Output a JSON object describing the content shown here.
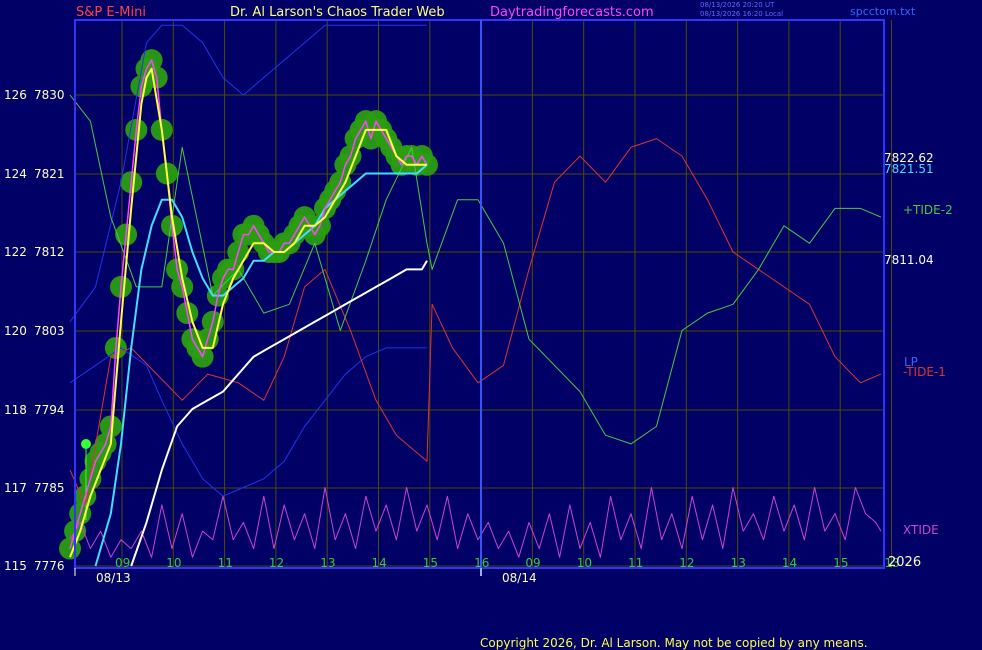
{
  "header": {
    "symbol": "S&P E-Mini",
    "site": "Dr. Al Larson's Chaos Trader Web",
    "url": "Daytradingforecasts.com",
    "time_line1": "08/13/2026 20:20 UT",
    "time_line2": "08/13/2026 16:20 Local",
    "filename": "spcctom.txt"
  },
  "footer": {
    "copyright": "Copyright 2026, Dr. Al Larson. May not be copied by any means."
  },
  "colors": {
    "background": "#000066",
    "frame": "#3333ff",
    "grid": "#4d4d00",
    "price": "#ff44ff",
    "fast_ma": "#ffff44",
    "slow_ma": "#44ddff",
    "long_ma": "#ffffff",
    "bands": "#2233ee",
    "tide_plus2": "#44cc44",
    "tide_minus1": "#dd3333",
    "xtide": "#cc44cc",
    "glow": "#2a9d12"
  },
  "chart_data": {
    "type": "line",
    "title": "S&P E-Mini",
    "y_axis_left": [
      {
        "label": "126",
        "value": 7830
      },
      {
        "label": "124",
        "value": 7821
      },
      {
        "label": "122",
        "value": 7812
      },
      {
        "label": "120",
        "value": 7803
      },
      {
        "label": "118",
        "value": 7794
      },
      {
        "label": "117",
        "value": 7785
      },
      {
        "label": "115",
        "value": 7776
      }
    ],
    "ylim": [
      7776,
      7835
    ],
    "x_hour_labels": [
      "09",
      "10",
      "11",
      "12",
      "13",
      "14",
      "15",
      "16",
      "09",
      "10",
      "11",
      "12",
      "13",
      "14",
      "15",
      "13"
    ],
    "date_labels": [
      "08/13",
      "08/14"
    ],
    "year_label": "2026",
    "right_values": [
      "7822.62",
      "7821.51",
      "7811.04"
    ],
    "series": [
      {
        "name": "+TIDE-2",
        "x": [
          0,
          0.4,
          0.8,
          1.3,
          1.8,
          2.2,
          2.8,
          3.3,
          3.8,
          4.3,
          4.8,
          5.3,
          5.8,
          6.2,
          6.7,
          7.0,
          7.1,
          7.6,
          8.0,
          8.5,
          9.0,
          9.5,
          10.0,
          10.5,
          11.0,
          11.5,
          12.0,
          12.5,
          13.0,
          13.5,
          14.0,
          14.5,
          15.0,
          15.5,
          15.9
        ],
        "values": [
          7830,
          7827,
          7816,
          7808,
          7808,
          7824,
          7807,
          7810,
          7805,
          7806,
          7813,
          7803,
          7811,
          7818,
          7824,
          7813,
          7810,
          7818,
          7818,
          7813,
          7802,
          7799,
          7796,
          7791,
          7790,
          7792,
          7803,
          7805,
          7806,
          7810,
          7815,
          7813,
          7817,
          7817,
          7816
        ]
      },
      {
        "name": "-TIDE-1",
        "x": [
          0,
          0.3,
          0.8,
          1.2,
          1.7,
          2.2,
          2.7,
          3.3,
          3.8,
          4.2,
          4.6,
          5.0,
          5.5,
          6.0,
          6.4,
          6.8,
          7.0,
          7.1,
          7.5,
          8.0,
          8.5,
          9.0,
          9.5,
          10.0,
          10.5,
          11.0,
          11.5,
          12.0,
          12.5,
          13.0,
          13.5,
          14.0,
          14.5,
          15.0,
          15.5,
          15.9
        ],
        "values": [
          7787,
          7783,
          7800,
          7801,
          7798,
          7795,
          7798,
          7797,
          7795,
          7800,
          7808,
          7810,
          7803,
          7795,
          7791,
          7789,
          7788,
          7806,
          7801,
          7797,
          7799,
          7810,
          7820,
          7823,
          7820,
          7824,
          7825,
          7823,
          7818,
          7812,
          7810,
          7808,
          7806,
          7800,
          7797,
          7798
        ]
      },
      {
        "name": "XTIDE",
        "x": [
          0,
          0.2,
          0.4,
          0.6,
          0.8,
          1.0,
          1.2,
          1.4,
          1.6,
          1.8,
          2.0,
          2.2,
          2.4,
          2.6,
          2.8,
          3.0,
          3.2,
          3.4,
          3.6,
          3.8,
          4.0,
          4.2,
          4.4,
          4.6,
          4.8,
          5.0,
          5.2,
          5.4,
          5.6,
          5.8,
          6.0,
          6.2,
          6.4,
          6.6,
          6.8,
          7.0,
          7.2,
          7.4,
          7.6,
          7.8,
          8.0,
          8.2,
          8.4,
          8.6,
          8.8,
          9.0,
          9.2,
          9.4,
          9.6,
          9.8,
          10.0,
          10.2,
          10.4,
          10.6,
          10.8,
          11.0,
          11.2,
          11.4,
          11.6,
          11.8,
          12.0,
          12.2,
          12.4,
          12.6,
          12.8,
          13.0,
          13.2,
          13.4,
          13.6,
          13.8,
          14.0,
          14.2,
          14.4,
          14.6,
          14.8,
          15.0,
          15.2,
          15.4,
          15.6,
          15.8,
          15.9
        ],
        "values": [
          7779,
          7781,
          7778,
          7780,
          7777,
          7779,
          7778,
          7780,
          7777,
          7783,
          7778,
          7782,
          7777,
          7780,
          7779,
          7784,
          7779,
          7781,
          7778,
          7784,
          7778,
          7783,
          7779,
          7782,
          7778,
          7785,
          7779,
          7782,
          7778,
          7784,
          7780,
          7783,
          7779,
          7785,
          7780,
          7783,
          7779,
          7784,
          7778,
          7782,
          7779,
          7781,
          7778,
          7780,
          7777,
          7781,
          7778,
          7782,
          7777,
          7783,
          7778,
          7781,
          7777,
          7784,
          7779,
          7782,
          7778,
          7785,
          7779,
          7782,
          7778,
          7784,
          7779,
          7783,
          7778,
          7785,
          7780,
          7782,
          7779,
          7784,
          7780,
          7783,
          7779,
          7785,
          7780,
          7782,
          7779,
          7785,
          7782,
          7781,
          7780
        ]
      },
      {
        "name": "S&P E-Mini",
        "x": [
          0.0,
          0.1,
          0.2,
          0.3,
          0.4,
          0.5,
          0.6,
          0.7,
          0.8,
          0.9,
          1.0,
          1.1,
          1.2,
          1.3,
          1.4,
          1.5,
          1.6,
          1.7,
          1.8,
          1.9,
          2.0,
          2.1,
          2.2,
          2.3,
          2.4,
          2.5,
          2.6,
          2.7,
          2.8,
          2.9,
          3.0,
          3.1,
          3.2,
          3.3,
          3.4,
          3.5,
          3.6,
          3.7,
          3.8,
          3.9,
          4.0,
          4.1,
          4.2,
          4.3,
          4.4,
          4.5,
          4.6,
          4.7,
          4.8,
          4.9,
          5.0,
          5.1,
          5.2,
          5.3,
          5.4,
          5.5,
          5.6,
          5.7,
          5.8,
          5.9,
          6.0,
          6.1,
          6.2,
          6.3,
          6.4,
          6.5,
          6.6,
          6.7,
          6.8,
          6.9,
          7.0
        ],
        "values": [
          7778,
          7780,
          7782,
          7784,
          7786,
          7788,
          7789,
          7790,
          7792,
          7801,
          7808,
          7814,
          7820,
          7826,
          7831,
          7833,
          7834,
          7832,
          7826,
          7821,
          7815,
          7810,
          7808,
          7805,
          7802,
          7801,
          7800,
          7802,
          7804,
          7807,
          7809,
          7810,
          7810,
          7812,
          7814,
          7814,
          7815,
          7814,
          7813,
          7812,
          7812,
          7812,
          7813,
          7813,
          7814,
          7815,
          7816,
          7815,
          7814,
          7815,
          7817,
          7818,
          7819,
          7820,
          7822,
          7823,
          7825,
          7826,
          7827,
          7825,
          7827,
          7826,
          7825,
          7824,
          7823,
          7822,
          7823,
          7823,
          7822,
          7823,
          7822
        ]
      },
      {
        "name": "fast average",
        "x": [
          0.0,
          0.2,
          0.4,
          0.6,
          0.8,
          1.0,
          1.2,
          1.4,
          1.5,
          1.6,
          1.8,
          2.0,
          2.2,
          2.4,
          2.6,
          2.8,
          3.0,
          3.2,
          3.4,
          3.6,
          3.8,
          4.0,
          4.2,
          4.4,
          4.6,
          4.8,
          5.0,
          5.2,
          5.4,
          5.6,
          5.8,
          6.0,
          6.2,
          6.4,
          6.6,
          6.8,
          7.0
        ],
        "values": [
          7777,
          7780,
          7784,
          7787,
          7790,
          7804,
          7817,
          7829,
          7832,
          7833,
          7826,
          7816,
          7809,
          7804,
          7801,
          7801,
          7806,
          7809,
          7811,
          7813,
          7813,
          7812,
          7812,
          7813,
          7815,
          7815,
          7816,
          7818,
          7820,
          7823,
          7826,
          7826,
          7826,
          7823,
          7822,
          7822,
          7822
        ]
      },
      {
        "name": "slow average",
        "x": [
          0.5,
          0.8,
          1.0,
          1.2,
          1.4,
          1.6,
          1.8,
          2.0,
          2.2,
          2.4,
          2.6,
          2.8,
          3.0,
          3.2,
          3.4,
          3.6,
          3.8,
          4.0,
          4.2,
          4.4,
          4.6,
          4.8,
          5.0,
          5.2,
          5.4,
          5.6,
          5.8,
          6.0,
          6.2,
          6.4,
          6.6,
          6.8,
          7.0
        ],
        "values": [
          7776,
          7782,
          7790,
          7801,
          7810,
          7815,
          7818,
          7818,
          7816,
          7812,
          7809,
          7807,
          7807,
          7808,
          7809,
          7811,
          7811,
          7812,
          7812,
          7813,
          7814,
          7815,
          7817,
          7818,
          7819,
          7820,
          7821,
          7821,
          7821,
          7821,
          7821,
          7821,
          7822
        ]
      },
      {
        "name": "long average",
        "x": [
          1.2,
          1.5,
          1.8,
          2.1,
          2.4,
          2.7,
          3.0,
          3.3,
          3.6,
          3.9,
          4.2,
          4.5,
          4.8,
          5.1,
          5.4,
          5.7,
          6.0,
          6.3,
          6.6,
          6.9,
          7.0
        ],
        "values": [
          7776,
          7781,
          7787,
          7792,
          7794,
          7795,
          7796,
          7798,
          7800,
          7801,
          7802,
          7803,
          7804,
          7805,
          7806,
          7807,
          7808,
          7809,
          7810,
          7810,
          7811
        ]
      },
      {
        "name": "upper band",
        "x": [
          0.0,
          0.5,
          1.0,
          1.5,
          1.8,
          2.2,
          2.6,
          3.0,
          3.4,
          3.8,
          4.2,
          4.6,
          5.0,
          5.4,
          5.8,
          6.2,
          6.6,
          7.0
        ],
        "values": [
          7804,
          7808,
          7820,
          7836,
          7838,
          7838,
          7836,
          7832,
          7830,
          7832,
          7834,
          7836,
          7838,
          7838,
          7838,
          7838,
          7838,
          7838
        ]
      },
      {
        "name": "lower band",
        "x": [
          0.0,
          0.5,
          1.0,
          1.5,
          1.8,
          2.2,
          2.6,
          3.0,
          3.4,
          3.8,
          4.2,
          4.6,
          5.0,
          5.4,
          5.8,
          6.2,
          6.6,
          7.0
        ],
        "values": [
          7797,
          7799,
          7801,
          7799,
          7795,
          7790,
          7786,
          7784,
          7785,
          7786,
          7788,
          7792,
          7795,
          7798,
          7800,
          7801,
          7801,
          7801
        ]
      }
    ],
    "series_labels": [
      "+TIDE-2",
      "-TIDE-1",
      "XTIDE",
      "LP"
    ]
  }
}
